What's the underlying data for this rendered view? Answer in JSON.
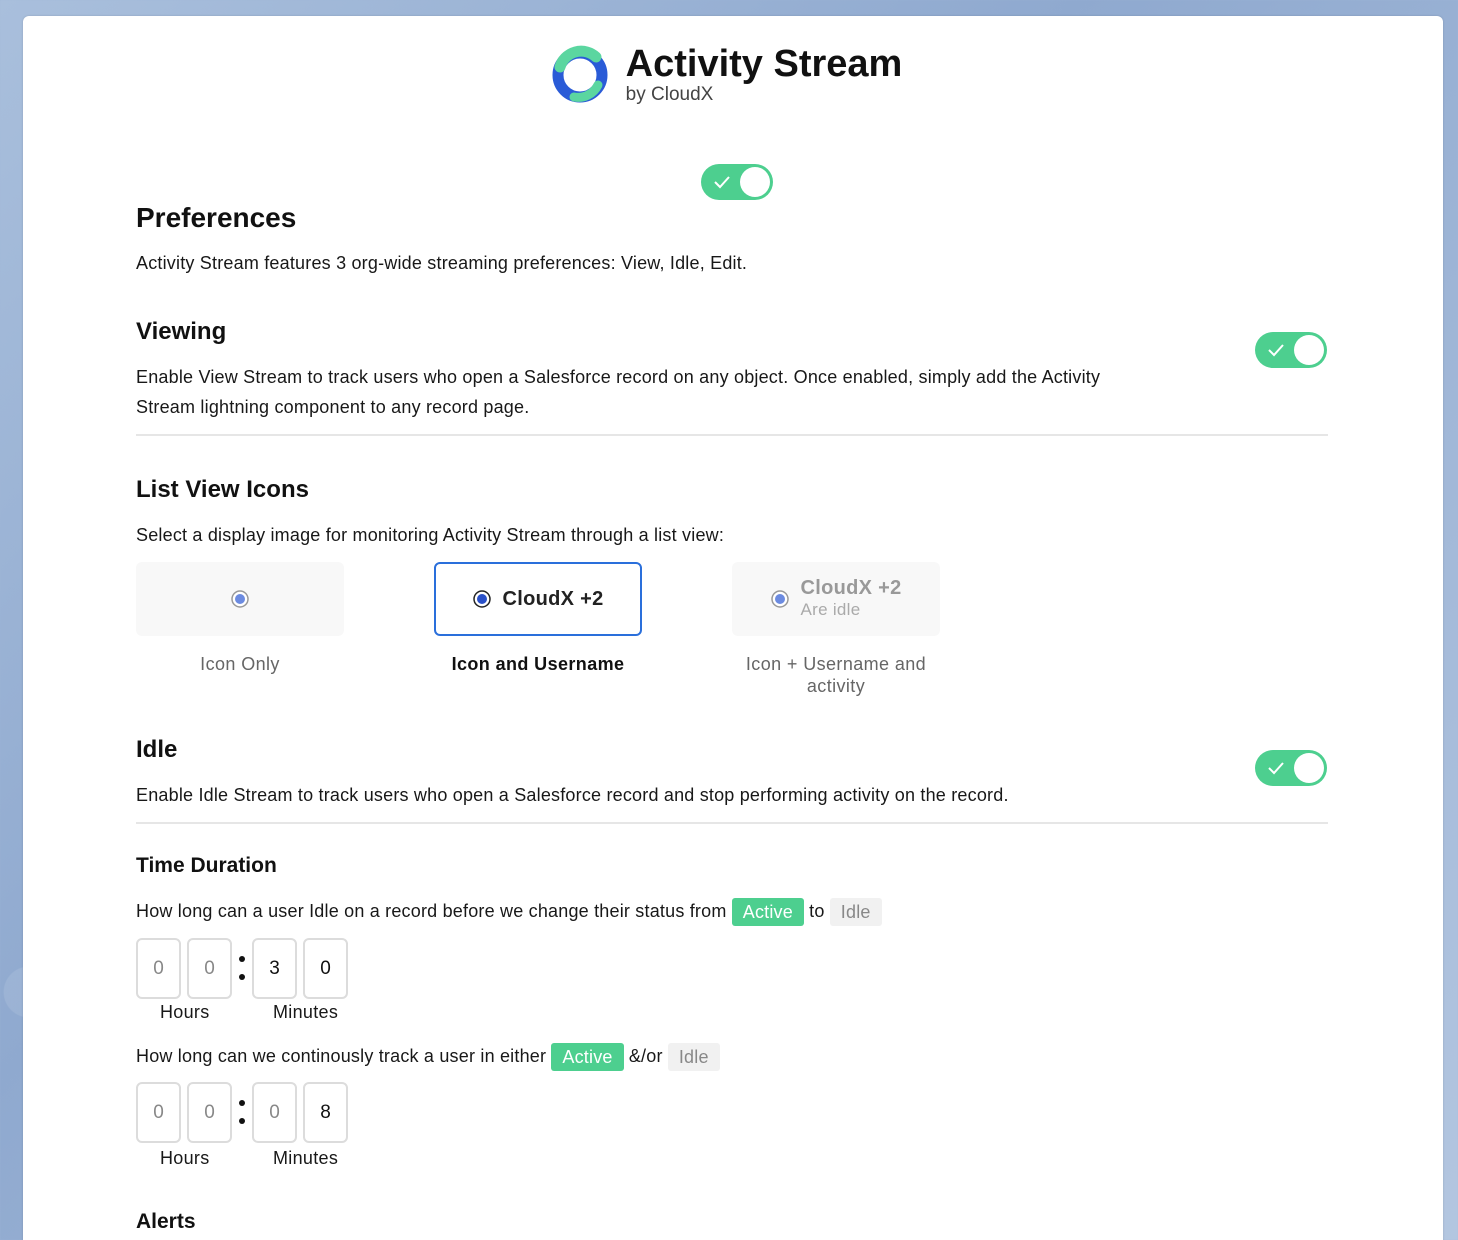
{
  "brand": {
    "title": "Activity Stream",
    "subtitle": "by CloudX"
  },
  "master_toggle": {
    "on": true
  },
  "preferences": {
    "title": "Preferences",
    "description": "Activity Stream features 3 org-wide streaming preferences: View, Idle, Edit."
  },
  "viewing": {
    "title": "Viewing",
    "description_line1": "Enable View Stream to track users who open a Salesforce record on any object. Once enabled, simply add the Activity",
    "description_line2": "Stream lightning component to any record page.",
    "enabled": true
  },
  "list_view_icons": {
    "title": "List View Icons",
    "description": "Select a display image for monitoring Activity Stream through a list view:",
    "options": [
      {
        "label": "Icon Only",
        "selected": false
      },
      {
        "label": "Icon and Username",
        "preview_text": "CloudX +2",
        "selected": true
      },
      {
        "label_line1": "Icon + Username and",
        "label_line2": "activity",
        "preview_text": "CloudX +2",
        "preview_sub": "Are idle",
        "selected": false
      }
    ]
  },
  "idle": {
    "title": "Idle",
    "description": "Enable Idle Stream to track users who open a Salesforce record and stop performing activity on the record.",
    "enabled": true
  },
  "time_duration": {
    "title": "Time Duration",
    "q1_prefix": "How long can a user Idle on a record before we change their status from",
    "q1_mid": "to",
    "q2_prefix": "How long can we continously track a user in either",
    "q2_mid": "&/or",
    "active_label": "Active",
    "idle_label": "Idle",
    "timer1": {
      "digits": [
        "0",
        "0",
        "3",
        "0"
      ]
    },
    "timer2": {
      "digits": [
        "0",
        "0",
        "0",
        "8"
      ]
    },
    "hours_label": "Hours",
    "minutes_label": "Minutes"
  },
  "alerts": {
    "title": "Alerts"
  },
  "colors": {
    "accent_green": "#4dcf8f",
    "selected_border": "#2a6fdb"
  }
}
